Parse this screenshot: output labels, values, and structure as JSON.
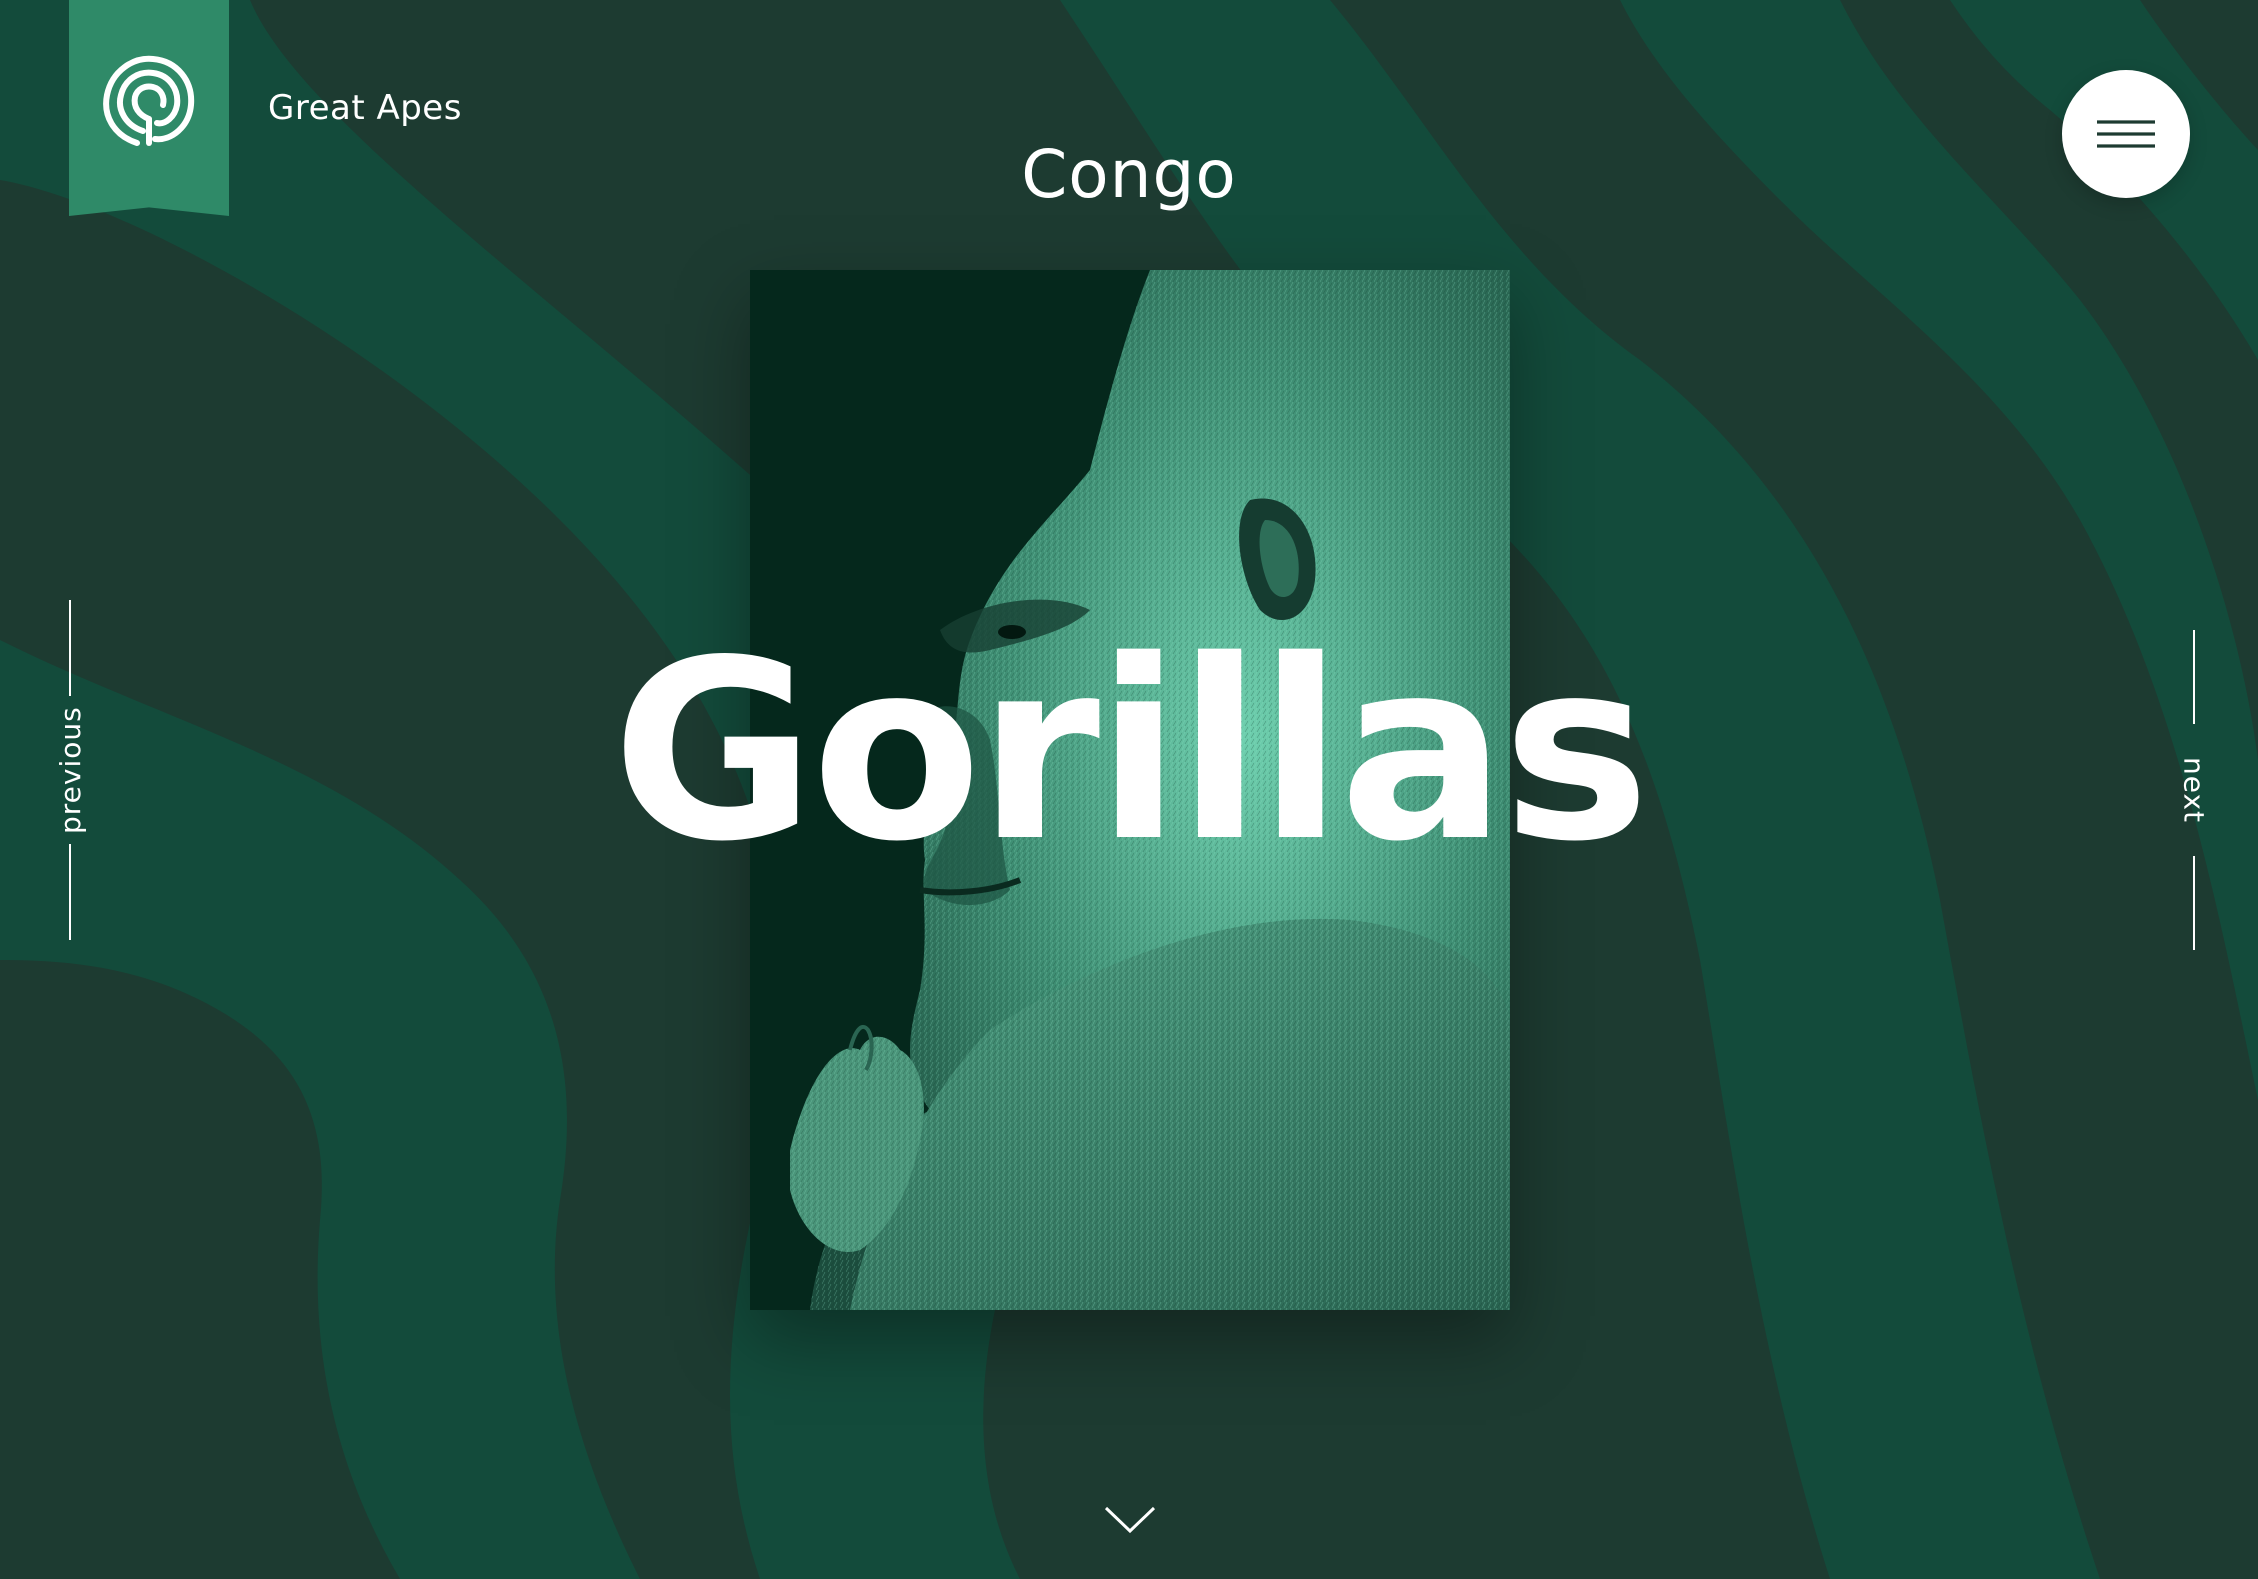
{
  "brand": {
    "name": "Great Apes",
    "logo_icon": "labyrinth-icon"
  },
  "region": {
    "title": "Congo"
  },
  "hero": {
    "title": "Gorillas",
    "image_subject": "gorilla-portrait"
  },
  "navigation": {
    "previous_label": "previous",
    "next_label": "next",
    "menu_icon": "hamburger-icon",
    "scroll_icon": "chevron-down-icon"
  },
  "colors": {
    "background": "#1d3b31",
    "wave": "#134b3b",
    "accent": "#2f8a68",
    "photo_tint": "#5fcfa8",
    "text": "#ffffff"
  }
}
